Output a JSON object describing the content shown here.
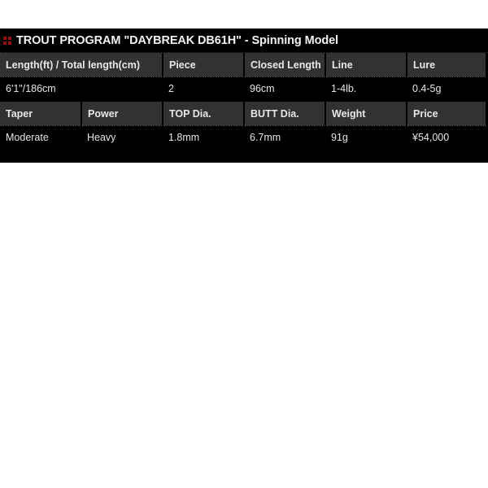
{
  "product": {
    "marker_icon": "four-dot-marker-icon",
    "title": "TROUT PROGRAM \"DAYBREAK  DB61H\" - Spinning Model"
  },
  "spec_tables": [
    {
      "headers": [
        "Length(ft) / Total length(cm)",
        "Piece",
        "Closed Length",
        "Line",
        "Lure"
      ],
      "values": [
        "6'1\"/186cm",
        "2",
        "96cm",
        "1-4lb.",
        "0.4-5g"
      ]
    },
    {
      "headers": [
        "Taper",
        "Power",
        "TOP Dia.",
        "BUTT Dia.",
        "Weight",
        "Price"
      ],
      "values": [
        "Moderate",
        "Heavy",
        "1.8mm",
        "6.7mm",
        "91g",
        "¥54,000"
      ]
    }
  ],
  "colors": {
    "panel_background": "#000000",
    "header_cell_background": "#323232",
    "marker_red": "#9c0d0d",
    "text_light": "#e8e8e8",
    "page_background": "#ffffff"
  }
}
